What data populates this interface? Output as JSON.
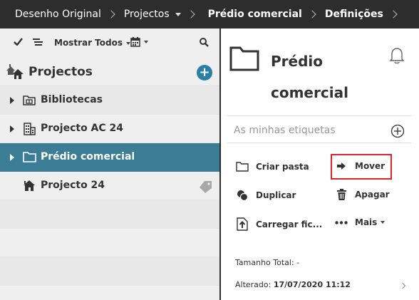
{
  "breadcrumb": {
    "items": [
      {
        "label": "Desenho Original",
        "bold": false
      },
      {
        "label": "Projectos",
        "bold": false,
        "dropdown": true
      },
      {
        "label": "Prédio comercial",
        "bold": true
      },
      {
        "label": "Definições",
        "bold": true
      }
    ]
  },
  "toolbar": {
    "filter_label": "Mostrar Todos"
  },
  "left": {
    "title": "Projectos",
    "rows": [
      {
        "label": "Bibliotecas",
        "icon": "library-icon",
        "expandable": true,
        "selected": false
      },
      {
        "label": "Projecto AC 24",
        "icon": "building-icon",
        "expandable": true,
        "selected": false
      },
      {
        "label": "Prédio comercial",
        "icon": "folder-icon",
        "expandable": true,
        "selected": true
      },
      {
        "label": "Projecto 24",
        "icon": "house-icon",
        "expandable": false,
        "selected": false
      }
    ]
  },
  "right": {
    "title": "Prédio comercial",
    "tags_placeholder": "As minhas etiquetas",
    "actions": {
      "create_folder": "Criar pasta",
      "move": "Mover",
      "duplicate": "Duplicar",
      "delete": "Apagar",
      "upload": "Carregar fic...",
      "more": "Mais"
    },
    "size_label": "Tamanho Total:",
    "size_value": "-",
    "modified_label": "Alterado:",
    "modified_value": "17/07/2020 11:12"
  },
  "colors": {
    "topbar": "#2d2d2d",
    "selected_row": "#3b7d95",
    "accent": "#2b7ea6",
    "highlight_border": "#d9262c"
  }
}
